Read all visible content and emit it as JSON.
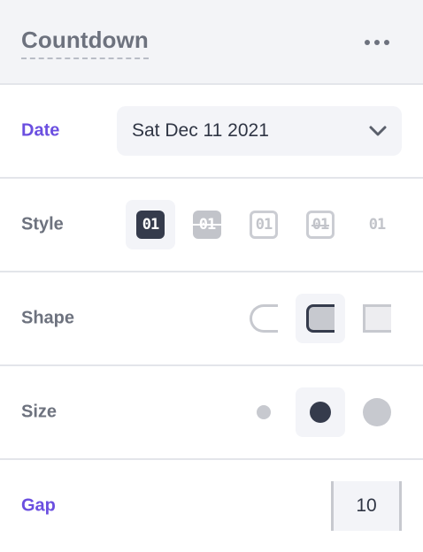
{
  "header": {
    "title": "Countdown",
    "menu_icon": "more-horizontal-icon"
  },
  "date": {
    "label": "Date",
    "value": "Sat Dec 11 2021",
    "chevron_icon": "chevron-down-icon"
  },
  "style": {
    "label": "Style",
    "options": [
      {
        "text": "01",
        "variant": "solid",
        "selected": true
      },
      {
        "text": "01",
        "variant": "split",
        "selected": false
      },
      {
        "text": "01",
        "variant": "outline",
        "selected": false
      },
      {
        "text": "01",
        "variant": "outline-split",
        "selected": false
      },
      {
        "text": "01",
        "variant": "plain",
        "selected": false
      }
    ]
  },
  "shape": {
    "label": "Shape",
    "options": [
      {
        "name": "round",
        "selected": false
      },
      {
        "name": "rounded",
        "selected": true
      },
      {
        "name": "square",
        "selected": false
      }
    ]
  },
  "size": {
    "label": "Size",
    "options": [
      {
        "name": "small",
        "selected": false
      },
      {
        "name": "medium",
        "selected": true
      },
      {
        "name": "large",
        "selected": false
      }
    ]
  },
  "gap": {
    "label": "Gap",
    "value": "10"
  },
  "colors": {
    "accent": "#6b4fe0",
    "label": "#6d727e",
    "dark": "#353b4c",
    "light": "#c2c4ca",
    "surface": "#f3f4f8",
    "divider": "#e3e5ea"
  }
}
